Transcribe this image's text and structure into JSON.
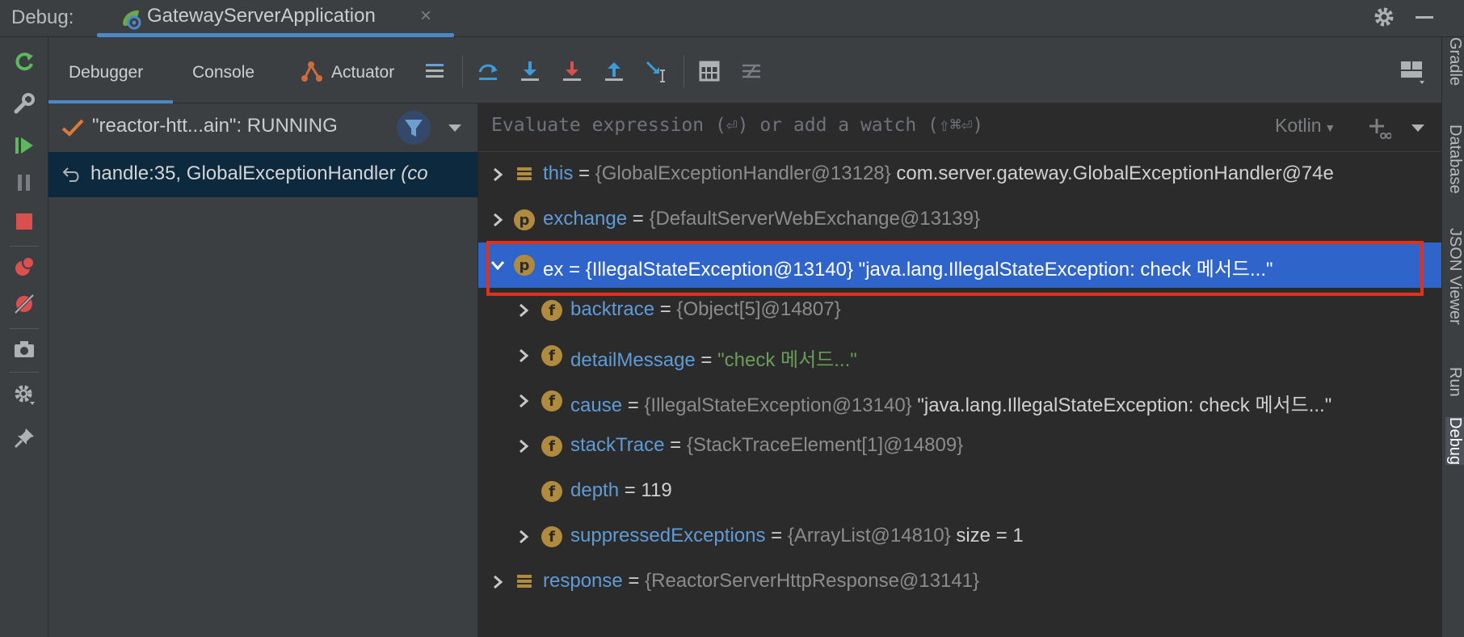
{
  "titlebar": {
    "label": "Debug:",
    "tab_title": "GatewayServerApplication",
    "close_glyph": "×"
  },
  "toolbar": {
    "tabs": {
      "debugger": "Debugger",
      "console": "Console",
      "actuator": "Actuator"
    }
  },
  "frames": {
    "thread": "\"reactor-htt...ain\": RUNNING",
    "frame_method": "handle:35, GlobalExceptionHandler",
    "frame_suffix": "(co"
  },
  "eval": {
    "placeholder": "Evaluate expression (⏎) or add a watch (⇧⌘⏎)",
    "language": "Kotlin"
  },
  "variables": [
    {
      "name": "this",
      "eq": " = ",
      "type": "{GlobalExceptionHandler@13128}",
      "value": " com.server.gateway.GlobalExceptionHandler@74e",
      "icon": "list-icon"
    },
    {
      "name": "exchange",
      "eq": " = ",
      "type": "{DefaultServerWebExchange@13139}",
      "icon": "p"
    },
    {
      "name": "ex",
      "eq": " = ",
      "type": "{IllegalStateException@13140}",
      "value": " \"java.lang.IllegalStateException: check 메서드...\"",
      "icon": "p",
      "selected": true
    },
    {
      "name": "backtrace",
      "eq": " = ",
      "type": "{Object[5]@14807}",
      "icon": "f"
    },
    {
      "name": "detailMessage",
      "eq": " = ",
      "str": "\"check 메서드...\"",
      "icon": "f"
    },
    {
      "name": "cause",
      "eq": " = ",
      "type": "{IllegalStateException@13140}",
      "value": " \"java.lang.IllegalStateException: check 메서드...\"",
      "icon": "f"
    },
    {
      "name": "stackTrace",
      "eq": " = ",
      "type": "{StackTraceElement[1]@14809}",
      "icon": "f"
    },
    {
      "name": "depth",
      "eq": " = ",
      "value": "119",
      "icon": "f"
    },
    {
      "name": "suppressedExceptions",
      "eq": " = ",
      "type": "{ArrayList@14810}",
      "value": "  size = 1",
      "icon": "f"
    },
    {
      "name": "response",
      "eq": " = ",
      "type": "{ReactorServerHttpResponse@13141}",
      "icon": "list-icon"
    }
  ],
  "icons": {
    "p": "p",
    "f": "f"
  },
  "right_stripe": {
    "gradle": "Gradle",
    "database": "Database",
    "json_viewer": "JSON Viewer",
    "run": "Run",
    "debug": "Debug"
  },
  "colors": {
    "accent": "#4a88c7",
    "selection": "#2f65ca",
    "highlight": "#e0311f"
  }
}
